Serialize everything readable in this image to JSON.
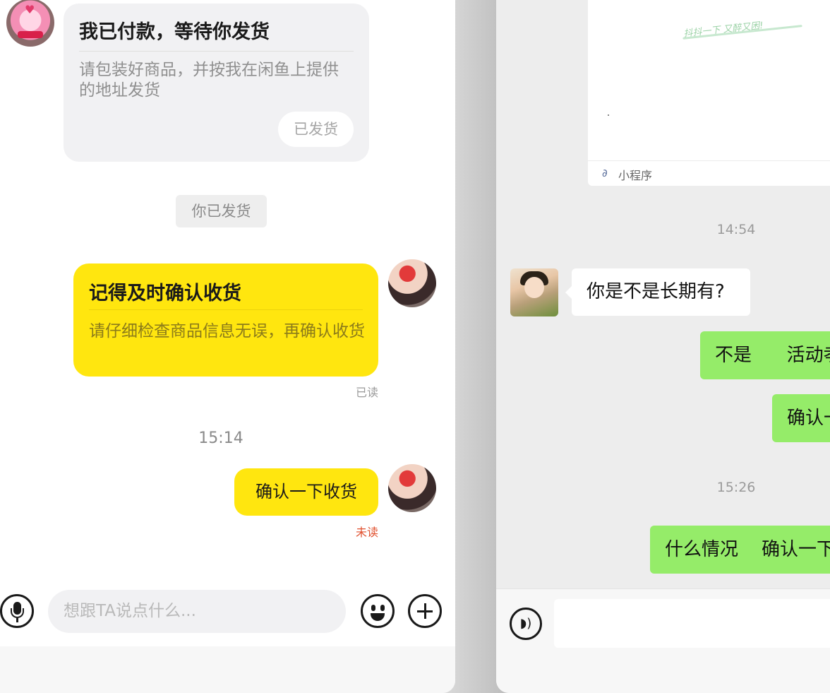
{
  "left_chat": {
    "incoming_card": {
      "title": "我已付款，等待你发货",
      "desc": "请包装好商品，并按我在闲鱼上提供的地址发货",
      "button": "已发货"
    },
    "system_note": "你已发货",
    "outgoing_card": {
      "title": "记得及时确认收货",
      "desc": "请仔细检查商品信息无误，再确认收货",
      "status": "已读"
    },
    "timestamp": "15:14",
    "outgoing_message": {
      "text": "确认一下收货",
      "status": "未读"
    },
    "input": {
      "placeholder": "想跟TA说点什么..."
    }
  },
  "right_chat": {
    "mini_program": {
      "doodle_text": "抖抖一下 又醉又困!",
      "label": "小程序"
    },
    "timestamp_1": "14:54",
    "incoming_message": "你是不是长期有?",
    "outgoing_messages": [
      "不是      活动孝",
      "确认一",
      "什么情况    确认一下"
    ],
    "timestamp_2": "15:26"
  },
  "colors": {
    "xianyu_yellow": "#ffe60f",
    "wechat_green": "#95ec69",
    "unread_red": "#e0502e"
  }
}
